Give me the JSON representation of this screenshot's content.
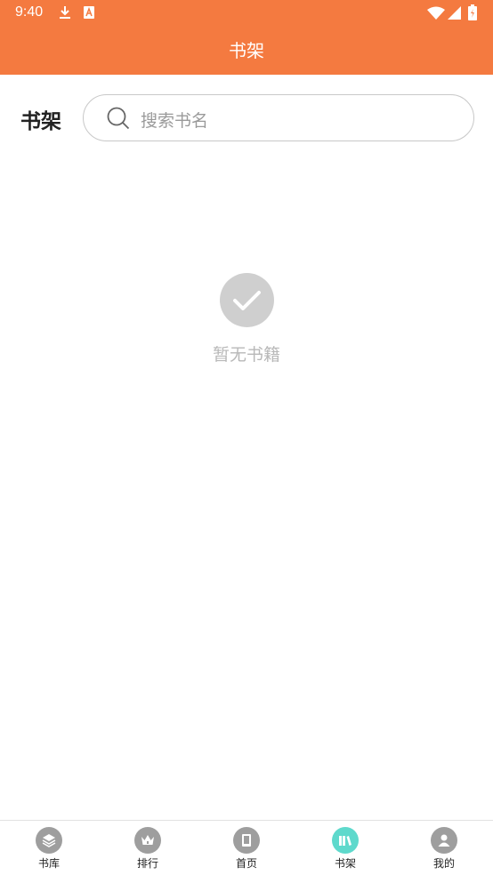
{
  "status_bar": {
    "time": "9:40",
    "icons": [
      "download-icon",
      "keyboard-icon",
      "wifi-icon",
      "signal-icon",
      "battery-icon"
    ]
  },
  "header": {
    "title": "书架"
  },
  "shelf": {
    "label": "书架",
    "search_placeholder": "搜索书名"
  },
  "empty_state": {
    "icon": "check-icon",
    "text": "暂无书籍"
  },
  "tabs": [
    {
      "label": "书库",
      "icon": "layers-icon"
    },
    {
      "label": "排行",
      "icon": "crown-icon"
    },
    {
      "label": "首页",
      "icon": "book-icon"
    },
    {
      "label": "书架",
      "icon": "bookshelf-icon",
      "active": true
    },
    {
      "label": "我的",
      "icon": "user-icon"
    }
  ],
  "colors": {
    "primary": "#f47a40",
    "tab_active": "#5ed9cc",
    "tab_inactive": "#9e9e9e",
    "empty_icon": "#cfcfcf"
  }
}
